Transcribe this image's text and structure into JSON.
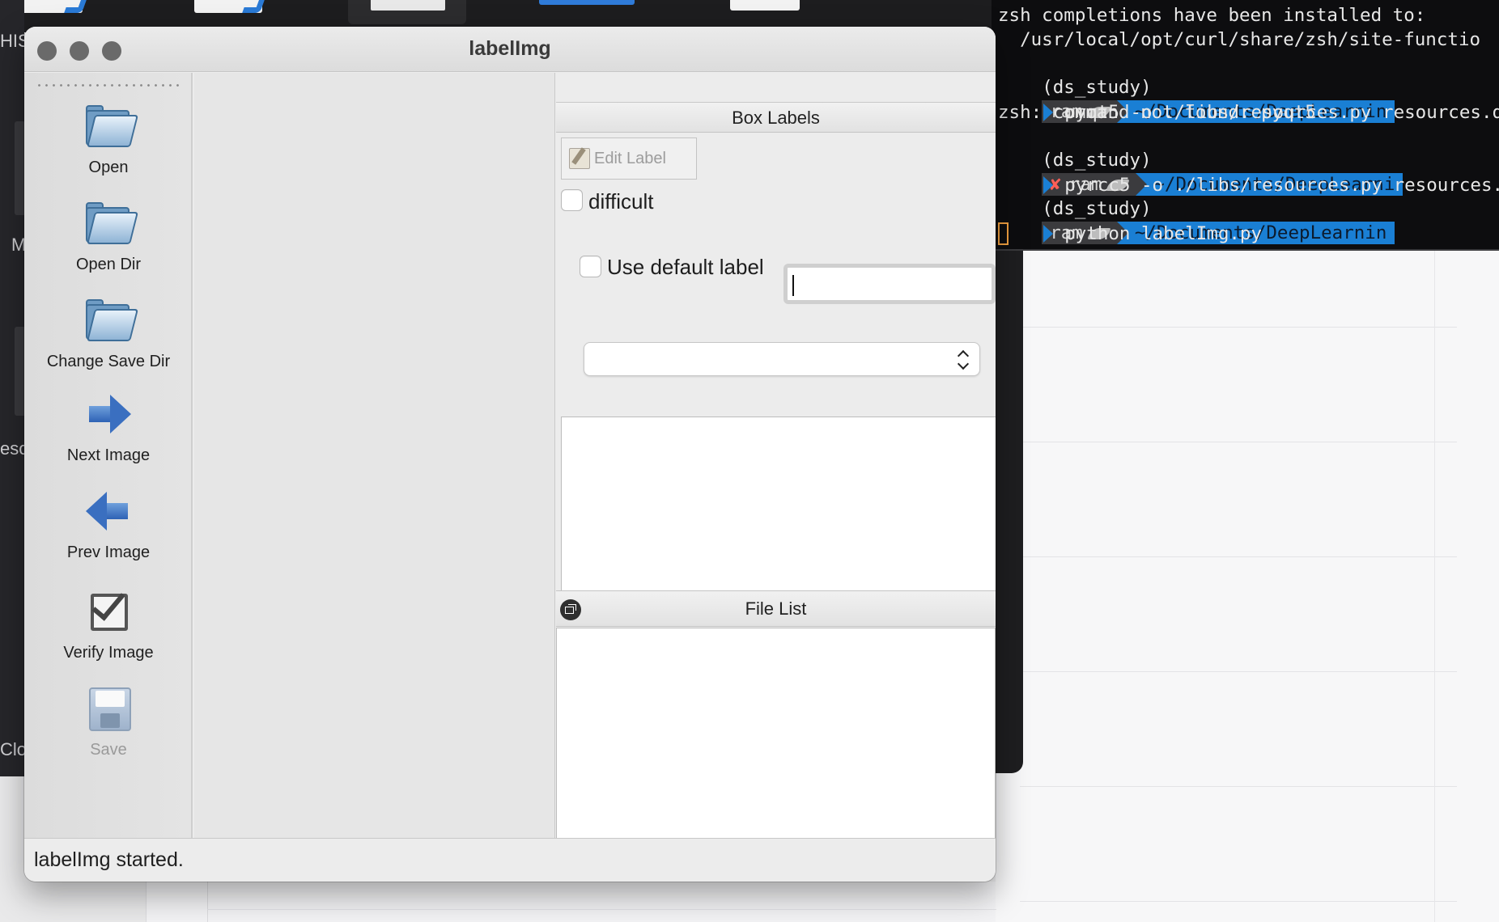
{
  "window": {
    "title": "labelImg"
  },
  "toolbar": {
    "items": [
      {
        "label": "Open",
        "icon": "open-folder-icon"
      },
      {
        "label": "Open Dir",
        "icon": "open-dir-folder-icon"
      },
      {
        "label": "Change Save Dir",
        "icon": "change-save-dir-folder-icon"
      },
      {
        "label": "Next Image",
        "icon": "right-arrow-icon"
      },
      {
        "label": "Prev Image",
        "icon": "left-arrow-icon"
      },
      {
        "label": "Verify Image",
        "icon": "checkbox-verify-icon"
      },
      {
        "label": "Save",
        "icon": "floppy-disk-icon",
        "disabled": true
      }
    ],
    "more_icon": "double-chevron-down-icon"
  },
  "box_labels_panel": {
    "title": "Box Labels",
    "edit_label_button": "Edit Label",
    "difficult_label": "difficult",
    "difficult_checked": false,
    "use_default_label": "Use default label",
    "use_default_checked": false,
    "default_label_value": "",
    "label_combo_value": ""
  },
  "file_list_panel": {
    "title": "File List"
  },
  "status": {
    "message": "labelImg started."
  },
  "terminal": {
    "lines": [
      "zsh completions have been installed to:",
      "  /usr/local/opt/curl/share/zsh/site-functio"
    ],
    "prompt_env": "(ds_study)",
    "prompt_user": "ram",
    "prompt_path_1": "~/Documents/DeepLearnin",
    "prompt_path_2": "~/Documents/DeepLearni",
    "prompt_path_3": "~/Documents/DeepLearnin",
    "cmd_1": "pyqt5 -o ./libs/resources.py resources.qrc",
    "error_1": "zsh: command not found: pyqt5",
    "cmd_2": "pyrcc5 -o ./libs/resources.py resources.qr",
    "cmd_3": "python labelImg.py",
    "error_mark": "✘"
  },
  "background": {
    "fragments": [
      "HIS",
      "M",
      "esc",
      "Clo"
    ]
  },
  "colors": {
    "terminal_bg": "#0d0d0f",
    "prompt_path_bg": "#1a7fd4",
    "error_red": "#ff5f57",
    "cursor_orange": "#f0a040"
  }
}
